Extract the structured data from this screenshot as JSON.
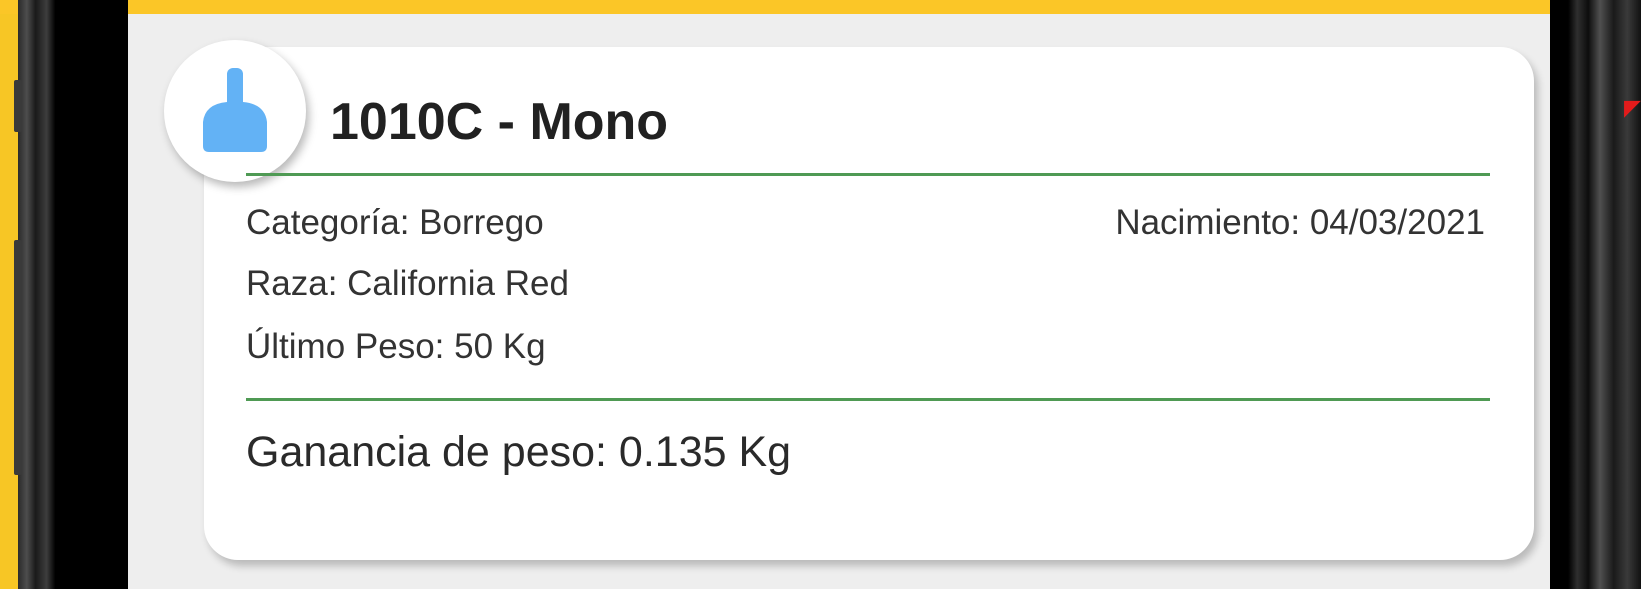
{
  "card": {
    "title": "1010C - Mono",
    "category": "Categoría: Borrego",
    "birth": "Nacimiento: 04/03/2021",
    "breed": "Raza: California Red",
    "last_weight": "Último Peso: 50 Kg",
    "weight_gain": "Ganancia de peso: 0.135 Kg"
  },
  "icons": {
    "avatar": "ear-tag-icon"
  },
  "colors": {
    "accent_green": "#4f9a54",
    "tag_blue": "#63b2f5",
    "frame_yellow": "#f7c625"
  }
}
